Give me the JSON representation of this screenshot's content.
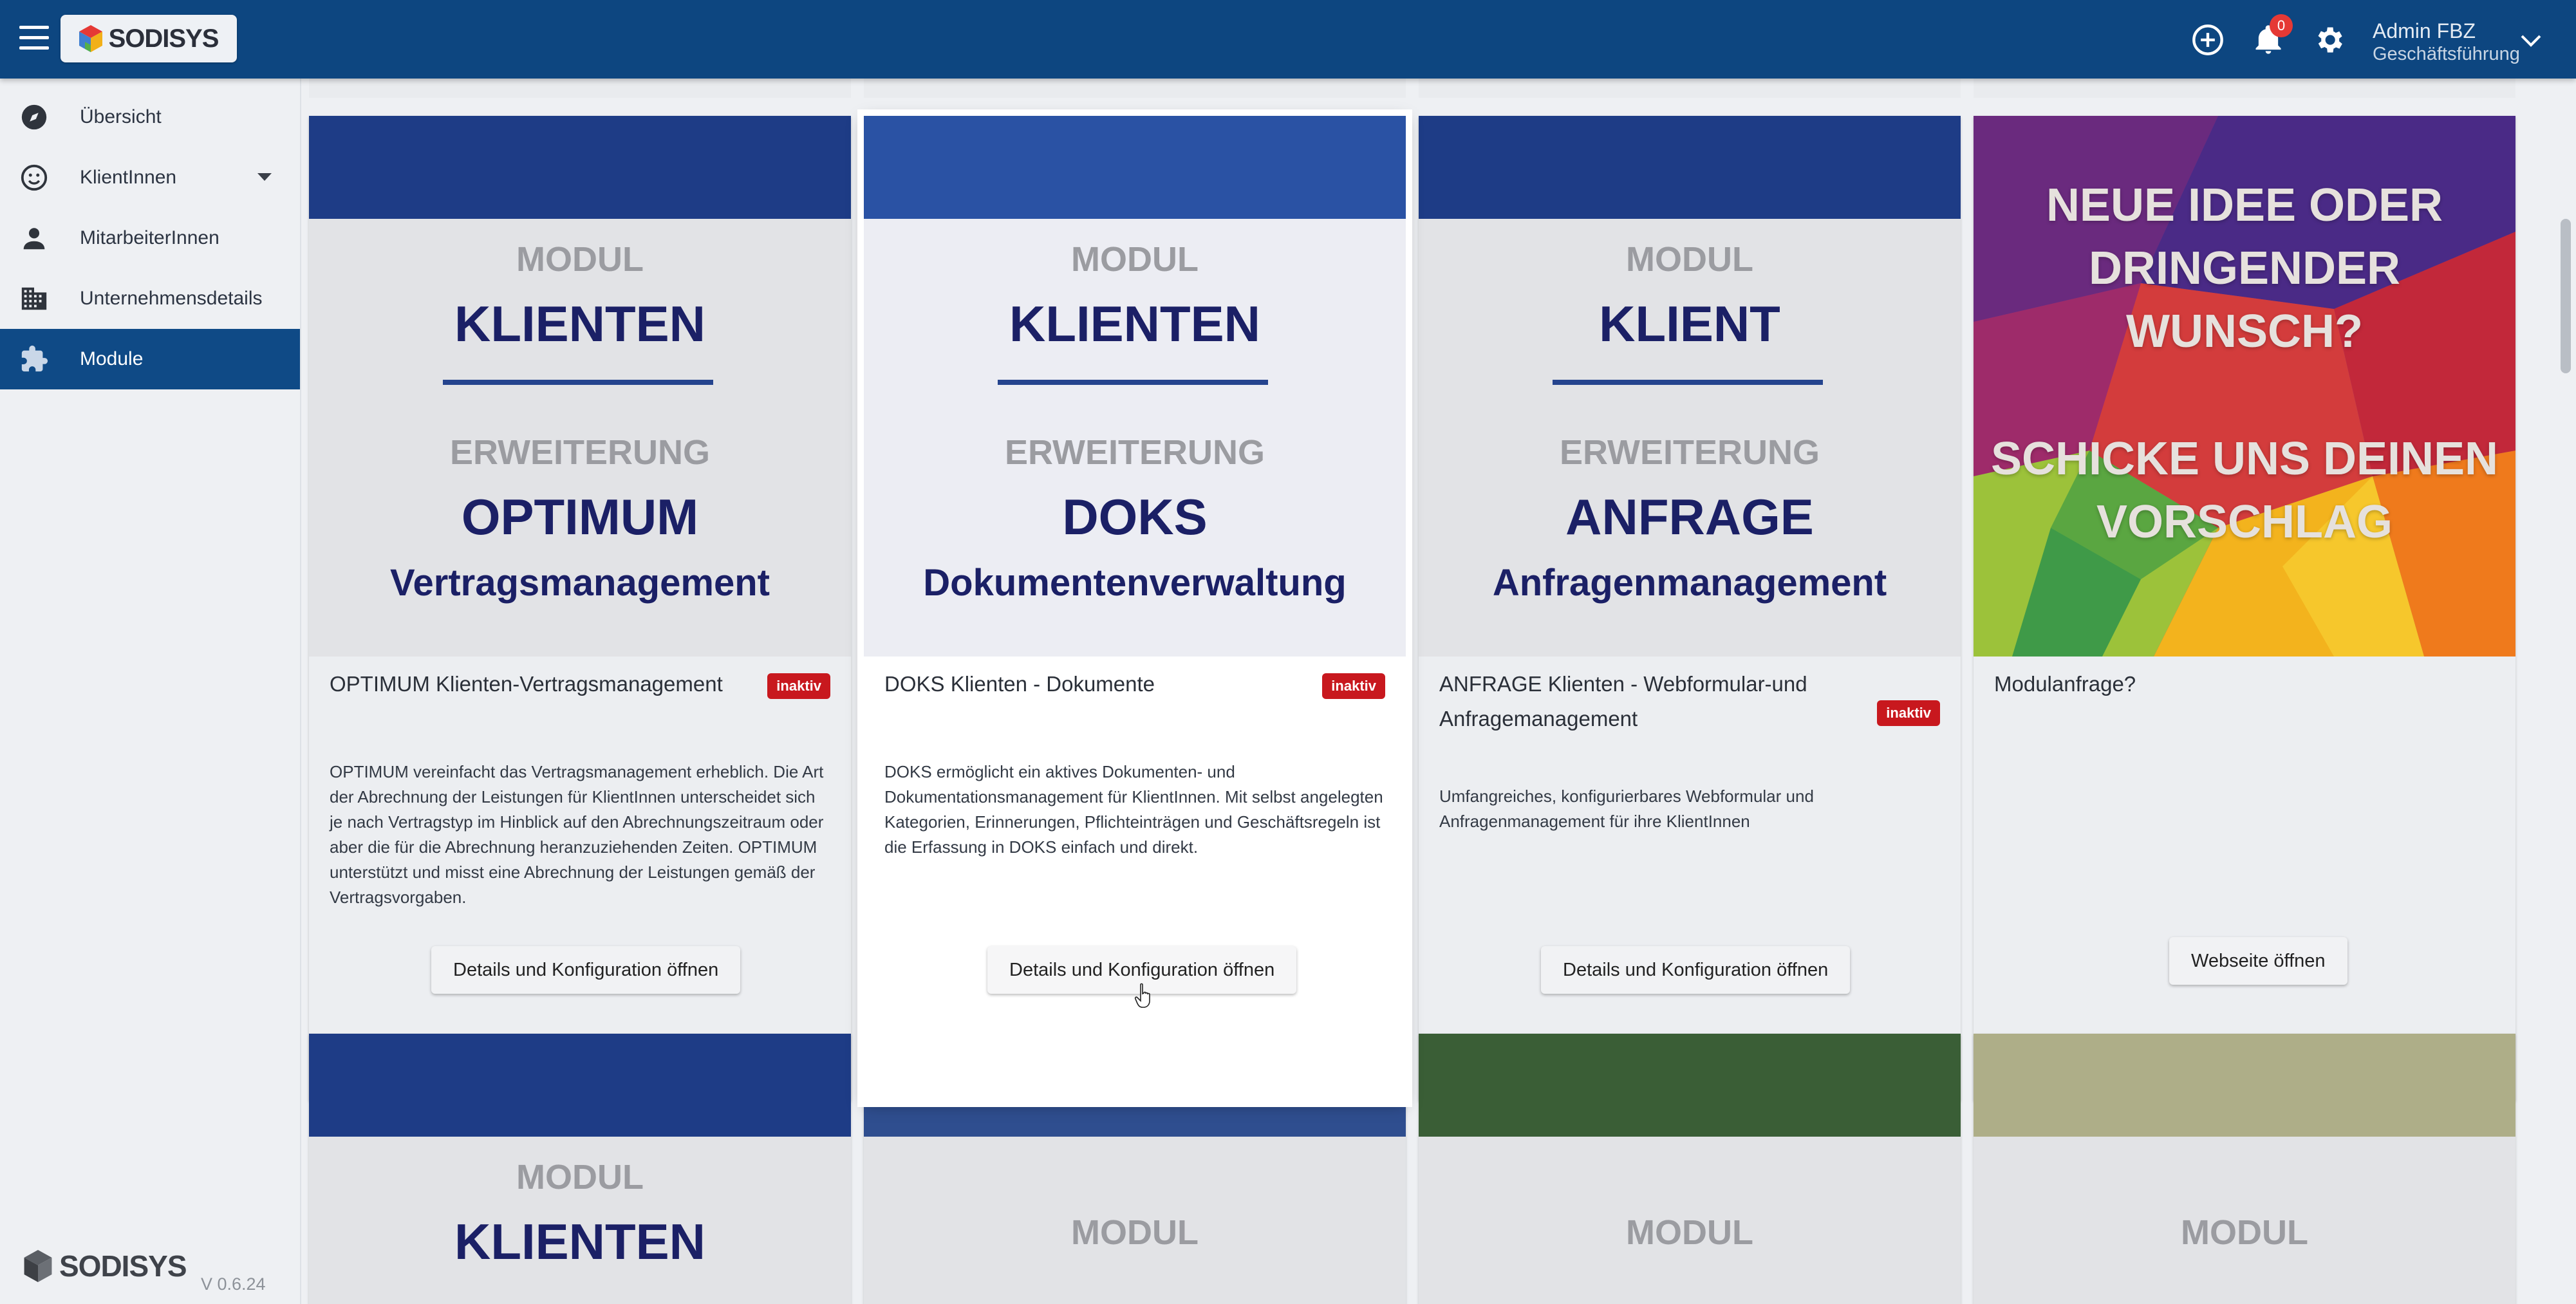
{
  "topbar": {
    "logo": "SODISYS",
    "notifications_count": "0",
    "user_name": "Admin FBZ",
    "user_role": "Geschäftsführung",
    "accent": "#0d4680"
  },
  "sidebar": {
    "items": [
      {
        "label": "Übersicht",
        "icon": "compass-icon"
      },
      {
        "label": "KlientInnen",
        "icon": "smiley-icon"
      },
      {
        "label": "MitarbeiterInnen",
        "icon": "person-icon"
      },
      {
        "label": "Unternehmensdetails",
        "icon": "building-icon"
      },
      {
        "label": "Module",
        "icon": "puzzle-icon"
      }
    ],
    "footer_logo": "SODISYS",
    "version": "V 0.6.24"
  },
  "cards": [
    {
      "modul": "MODUL",
      "name": "KLIENTEN",
      "erweiterung": "ERWEITERUNG",
      "ext": "OPTIMUM",
      "desc": "Vertragsmanagement",
      "title": "OPTIMUM Klienten-Vertragsmanagement",
      "status": "inaktiv",
      "text": "OPTIMUM vereinfacht das Vertragsmanagement erheblich. Die Art der Abrechnung der Leistungen für KlientInnen unterscheidet sich je nach Vertragstyp im Hinblick auf den Abrechnungszeitraum oder aber die für die Abrechnung heranzuziehenden Zeiten. OPTIMUM unterstützt und misst eine Abrechnung der Leistungen gemäß der Vertragsvorgaben.",
      "button": "Details und Konfiguration öffnen",
      "header_color": "#1e3c86"
    },
    {
      "modul": "MODUL",
      "name": "KLIENTEN",
      "erweiterung": "ERWEITERUNG",
      "ext": "DOKS",
      "desc": "Dokumentenverwaltung",
      "title": "DOKS Klienten - Dokumente",
      "status": "inaktiv",
      "text": "DOKS ermöglicht ein aktives Dokumenten- und Dokumentationsmanagement für KlientInnen. Mit selbst angelegten Kategorien, Erinnerungen, Pflichteinträgen und Geschäftsregeln ist die Erfassung in DOKS einfach und direkt.",
      "button": "Details und Konfiguration öffnen",
      "header_color": "#2a52a4"
    },
    {
      "modul": "MODUL",
      "name": "KLIENT",
      "erweiterung": "ERWEITERUNG",
      "ext": "ANFRAGE",
      "desc": "Anfragenmanagement",
      "title": "ANFRAGE Klienten - Webformular-und Anfragemanagement",
      "status": "inaktiv",
      "text": "Umfangreiches, konfigurierbares Webformular und Anfragenmanagement für ihre KlientInnen",
      "button": "Details und Konfiguration öffnen",
      "header_color": "#1e3c86"
    },
    {
      "idea_top": "NEUE IDEE ODER DRINGENDER WUNSCH?",
      "idea_bottom": "SCHICKE UNS DEINEN VORSCHLAG",
      "title": "Modulanfrage?",
      "button": "Webseite öffnen"
    }
  ],
  "next_row": [
    {
      "modul": "MODUL",
      "name": "KLIENTEN",
      "header_color": "#1e3c86"
    },
    {
      "modul": "MODUL",
      "header_color": "#2f4e8f"
    },
    {
      "modul": "MODUL",
      "header_color": "#3a5e36"
    },
    {
      "modul": "MODUL",
      "header_color": "#aeae88"
    }
  ]
}
